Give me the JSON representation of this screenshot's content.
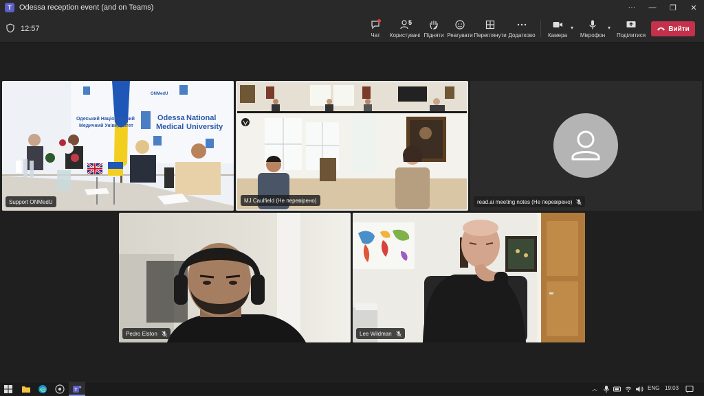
{
  "window": {
    "title": "Odessa reception event (and on Teams)",
    "controls": [
      "···",
      "—",
      "❐",
      "✕"
    ]
  },
  "meeting": {
    "elapsed": "12:57",
    "toolbar": {
      "chat": "Чат",
      "people": "Користувачі",
      "people_count": "5",
      "raise": "Підняти",
      "react": "Реагувати",
      "view": "Переглянути",
      "more": "Додатково",
      "camera": "Камера",
      "mic": "Мікрофон",
      "share": "Поділитися",
      "leave": "Вийти"
    }
  },
  "participants": [
    {
      "name": "Support ONMedU"
    },
    {
      "name": "MJ Caulfield (Не перевірено)"
    },
    {
      "name": "read.ai meeting notes (Не перевірено)"
    },
    {
      "name": "Pedro Elston"
    },
    {
      "name": "Lee Wildman"
    }
  ],
  "room_signage": {
    "uni_en_1": "Odessa",
    "uni_en_2": "National",
    "uni_en_3": "Medical",
    "uni_en_4": "University",
    "uni_ua_1": "Одеський Національний",
    "uni_ua_2": "Медичний Університет",
    "brand": "ONMedU"
  },
  "taskbar": {
    "language": "ENG",
    "clock": "19:03"
  },
  "colors": {
    "accent": "#5b5fc7",
    "leave": "#c4314b",
    "chat_dot": "#e0453d"
  }
}
